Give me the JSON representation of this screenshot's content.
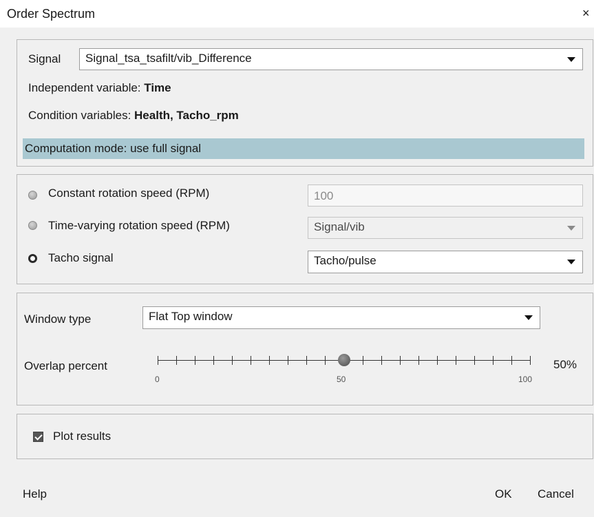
{
  "window": {
    "title": "Order Spectrum",
    "close_label": "×"
  },
  "signal": {
    "label": "Signal",
    "selected": "Signal_tsa_tsafilt/vib_Difference",
    "independent_label": "Independent variable: ",
    "independent_value": "Time",
    "condition_label": "Condition variables: ",
    "condition_value": "Health, Tacho_rpm",
    "computation_mode": "Computation mode: use full signal"
  },
  "rotation": {
    "constant_label": "Constant rotation speed (RPM)",
    "constant_value": "100",
    "time_varying_label": "Time-varying rotation speed (RPM)",
    "time_varying_value": "Signal/vib",
    "tacho_label": "Tacho signal",
    "tacho_value": "Tacho/pulse",
    "selected_option": "Tacho signal"
  },
  "window_settings": {
    "window_type_label": "Window type",
    "window_type_value": "Flat Top window",
    "overlap_label": "Overlap percent",
    "overlap_value": 50,
    "overlap_display": "50%",
    "slider_min": "0",
    "slider_mid": "50",
    "slider_max": "100"
  },
  "plot": {
    "label": "Plot results",
    "checked": true
  },
  "footer": {
    "help_label": "Help",
    "ok_label": "OK",
    "cancel_label": "Cancel"
  },
  "colors": {
    "highlight": "#a9c8d1",
    "background": "#f0f0f0"
  }
}
